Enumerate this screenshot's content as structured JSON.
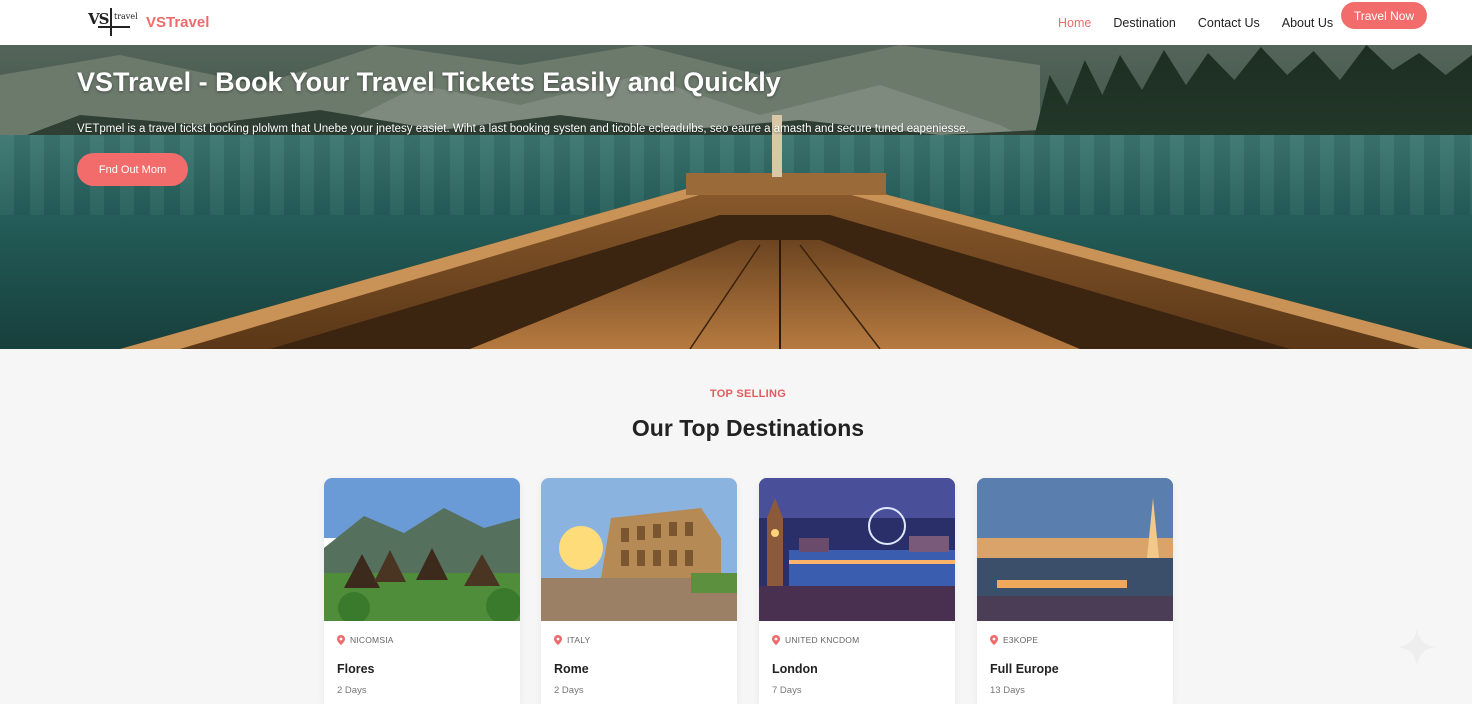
{
  "nav": {
    "logo_mark": "VS",
    "logo_mark_small": "travel",
    "logo_text": "VSTravel",
    "links": [
      "Home",
      "Destination",
      "Contact Us",
      "About Us"
    ],
    "cta": "Travel Now",
    "active_index": 0
  },
  "hero": {
    "title": "VSTravel - Book Your Travel Tickets Easily and Quickly",
    "description": "VETpmel is a travel tickst bocking plolwm that Unebe your jnetesy easiet. Wiht a last booking systen and ticoble ecleadulbs, seo eaure a amasth and secure tuned eapeniesse.",
    "button": "Fnd Out Mom"
  },
  "section": {
    "kicker": "TOP SELLING",
    "title": "Our Top Destinations"
  },
  "destinations": [
    {
      "location": "NICOMSIA",
      "name": "Flores",
      "duration": "2 Days"
    },
    {
      "location": "ITALY",
      "name": "Rome",
      "duration": "2 Days"
    },
    {
      "location": "UNITED KNCDOM",
      "name": "London",
      "duration": "7 Days"
    },
    {
      "location": "E3KOPE",
      "name": "Full Europe",
      "duration": "13 Days"
    }
  ],
  "colors": {
    "accent": "#f26c6c",
    "text": "#222222",
    "background": "#f6f6f6"
  }
}
